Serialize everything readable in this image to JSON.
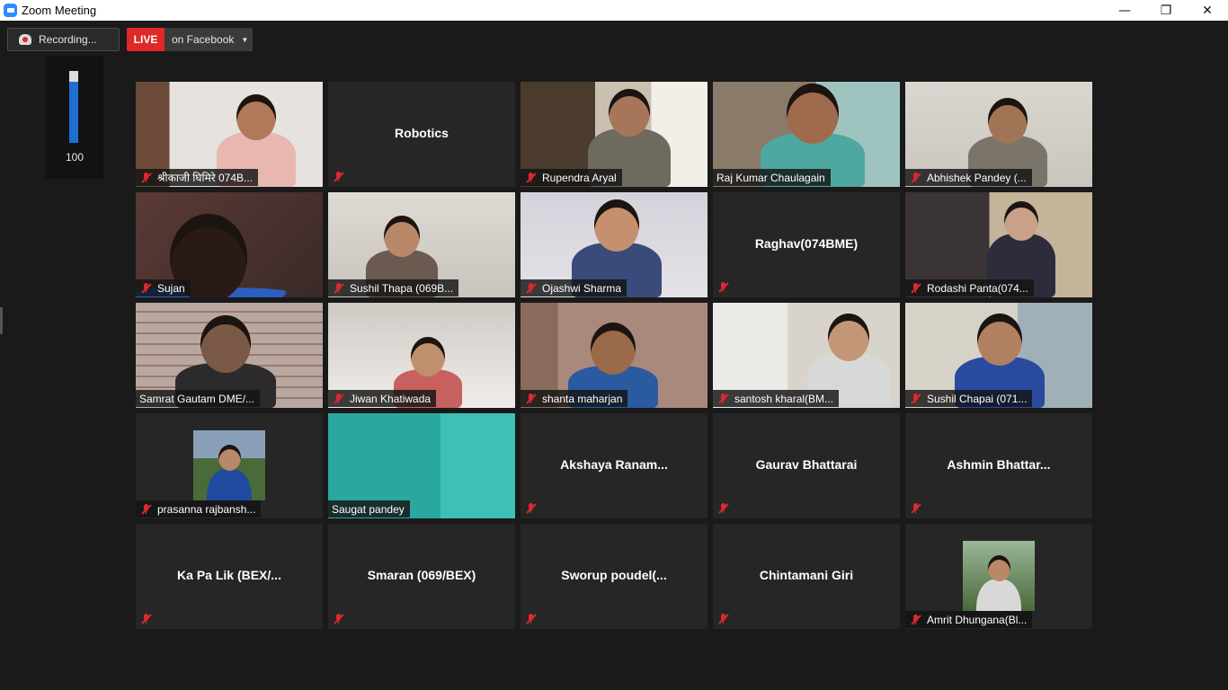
{
  "window": {
    "title": "Zoom Meeting",
    "controls": [
      "—",
      "❐",
      "✕"
    ]
  },
  "toolbar": {
    "recording_label": "Recording...",
    "live_badge": "LIVE",
    "live_destination": "on Facebook",
    "live_caret": "▼"
  },
  "volume": {
    "value_label": "100",
    "level": 0.85
  },
  "participants": [
    {
      "name": "श्रीकाजी घिमिरे 074B...",
      "video": true,
      "muted": true
    },
    {
      "name": "Robotics",
      "video": false,
      "muted": true
    },
    {
      "name": "Rupendra Aryal",
      "video": true,
      "muted": true
    },
    {
      "name": "Raj Kumar Chaulagain",
      "video": true,
      "muted": false,
      "active_speaker": true
    },
    {
      "name": "Abhishek Pandey (...",
      "video": true,
      "muted": true
    },
    {
      "name": "Sujan",
      "video": true,
      "muted": true
    },
    {
      "name": "Sushil Thapa (069B...",
      "video": true,
      "muted": true
    },
    {
      "name": "Ojashwi Sharma",
      "video": true,
      "muted": true
    },
    {
      "name": "Raghav(074BME)",
      "video": false,
      "muted": true
    },
    {
      "name": "Rodashi Panta(074...",
      "video": true,
      "muted": true
    },
    {
      "name": "Samrat Gautam DME/...",
      "video": true,
      "muted": false
    },
    {
      "name": "Jiwan Khatiwada",
      "video": true,
      "muted": true
    },
    {
      "name": "shanta maharjan",
      "video": true,
      "muted": true
    },
    {
      "name": "santosh kharal(BM...",
      "video": true,
      "muted": true
    },
    {
      "name": "Sushil Chapai (071...",
      "video": true,
      "muted": true
    },
    {
      "name": "prasanna rajbansh...",
      "video": "profile",
      "muted": true
    },
    {
      "name": "Saugat pandey",
      "video": true,
      "muted": false
    },
    {
      "name": "Akshaya  Ranam...",
      "video": false,
      "muted": true
    },
    {
      "name": "Gaurav Bhattarai",
      "video": false,
      "muted": true
    },
    {
      "name": "Ashmin  Bhattar...",
      "video": false,
      "muted": true
    },
    {
      "name": "Ka Pa Lik (BEX/...",
      "video": false,
      "muted": true
    },
    {
      "name": "Smaran (069/BEX)",
      "video": false,
      "muted": true
    },
    {
      "name": "Sworup  poudel(...",
      "video": false,
      "muted": true
    },
    {
      "name": "Chintamani Giri",
      "video": false,
      "muted": true
    },
    {
      "name": "Amrit Dhungana(Bl...",
      "video": "profile",
      "muted": true
    }
  ],
  "colors": {
    "background": "#1a1a1a",
    "tile": "#262626",
    "active_speaker_border": "#d8f26a",
    "mute_red": "#e0282f",
    "live_red": "#e02828",
    "volume_blue": "#1e6fd1"
  }
}
